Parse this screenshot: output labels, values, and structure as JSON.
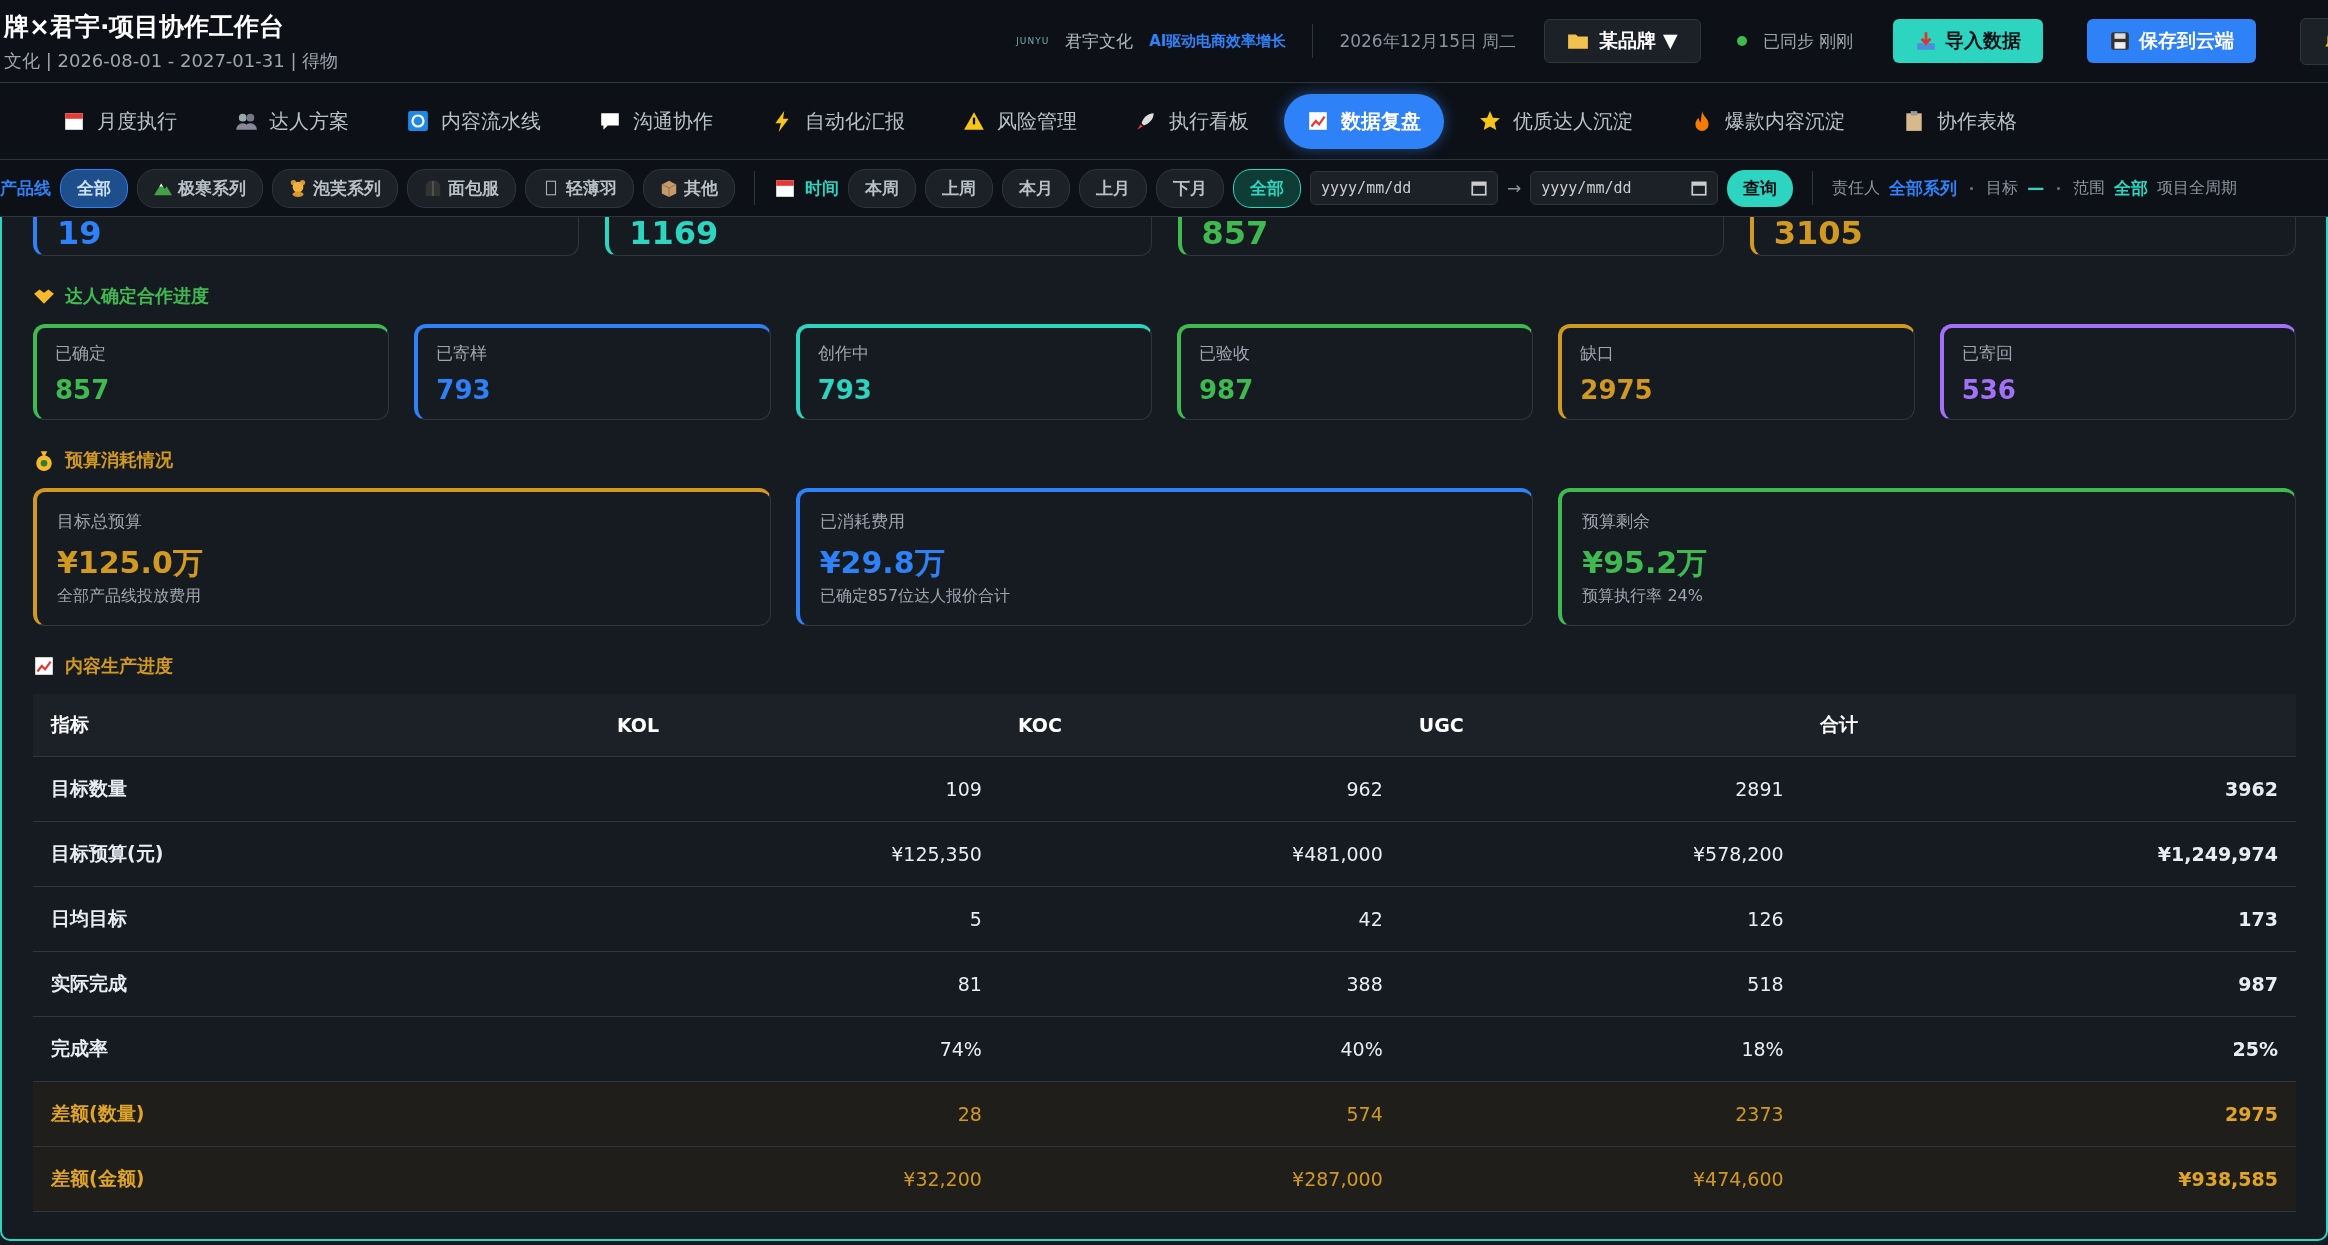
{
  "header": {
    "title": "牌×君宇·项目协作工作台",
    "subtitle": "文化 | 2026-08-01 - 2027-01-31 | 得物",
    "logo_text": "JUNYU",
    "company": "君宇文化",
    "slogan": "AI驱动电商效率增长",
    "date": "2026年12月15日 周二",
    "brand": "某品牌",
    "brand_caret": "▼",
    "sync_status": "已同步 刚刚",
    "import_button": "导入数据",
    "save_button": "保存到云端"
  },
  "nav_tabs": [
    {
      "label": "月度执行",
      "selected": false
    },
    {
      "label": "达人方案",
      "selected": false
    },
    {
      "label": "内容流水线",
      "selected": false
    },
    {
      "label": "沟通协作",
      "selected": false
    },
    {
      "label": "自动化汇报",
      "selected": false
    },
    {
      "label": "风险管理",
      "selected": false
    },
    {
      "label": "执行看板",
      "selected": false
    },
    {
      "label": "数据复盘",
      "selected": true
    },
    {
      "label": "优质达人沉淀",
      "selected": false
    },
    {
      "label": "爆款内容沉淀",
      "selected": false
    },
    {
      "label": "协作表格",
      "selected": false
    }
  ],
  "filters": {
    "product_label": "产品线",
    "products": [
      {
        "label": "全部",
        "selected": true
      },
      {
        "label": "极寒系列",
        "selected": false
      },
      {
        "label": "泡芙系列",
        "selected": false
      },
      {
        "label": "面包服",
        "selected": false
      },
      {
        "label": "轻薄羽",
        "selected": false
      },
      {
        "label": "其他",
        "selected": false
      }
    ],
    "time_label": "时间",
    "periods": [
      {
        "label": "本周",
        "selected": false
      },
      {
        "label": "上周",
        "selected": false
      },
      {
        "label": "本月",
        "selected": false
      },
      {
        "label": "上月",
        "selected": false
      },
      {
        "label": "下月",
        "selected": false
      },
      {
        "label": "全部",
        "selected": true
      }
    ],
    "date_from": {
      "placeholder": "yyyy/mm/dd"
    },
    "date_arrow": "→",
    "date_to": {
      "placeholder": "yyyy/mm/dd"
    },
    "query_button": "查询",
    "summary": [
      {
        "label": "责任人",
        "value": "全部系列",
        "color": "#2f81f7"
      },
      {
        "label": "目标",
        "value": "—",
        "color": "#2dd4bf"
      },
      {
        "label": "范围",
        "value": "全部",
        "color": "#2dd4bf"
      }
    ],
    "summary_note": "项目全周期"
  },
  "top_cards": [
    {
      "value": "19",
      "color": "#2f81f7"
    },
    {
      "value": "1169",
      "color": "#2dd4bf"
    },
    {
      "value": "857",
      "color": "#3fb950"
    },
    {
      "value": "3105",
      "color": "#d29922"
    }
  ],
  "progress": {
    "title": "达人确定合作进度",
    "cards": [
      {
        "label": "已确定",
        "value": "857",
        "color": "#3fb950"
      },
      {
        "label": "已寄样",
        "value": "793",
        "color": "#2f81f7"
      },
      {
        "label": "创作中",
        "value": "793",
        "color": "#2dd4bf"
      },
      {
        "label": "已验收",
        "value": "987",
        "color": "#3fb950"
      },
      {
        "label": "缺口",
        "value": "2975",
        "color": "#d29922"
      },
      {
        "label": "已寄回",
        "value": "536",
        "color": "#a371f7"
      }
    ]
  },
  "budget": {
    "title": "预算消耗情况",
    "cards": [
      {
        "label": "目标总预算",
        "value": "¥125.0万",
        "note": "全部产品线投放费用",
        "color": "#d29922"
      },
      {
        "label": "已消耗费用",
        "value": "¥29.8万",
        "note": "已确定857位达人报价合计",
        "color": "#2f81f7"
      },
      {
        "label": "预算剩余",
        "value": "¥95.2万",
        "note": "预算执行率 24%",
        "color": "#3fb950"
      }
    ]
  },
  "content": {
    "title": "内容生产进度",
    "columns": [
      "指标",
      "KOL",
      "KOC",
      "UGC",
      "合计"
    ],
    "rows": [
      {
        "kind": "normal",
        "cells": [
          "目标数量",
          "109",
          "962",
          "2891",
          "3962"
        ]
      },
      {
        "kind": "normal",
        "cells": [
          "目标预算(元)",
          "¥125,350",
          "¥481,000",
          "¥578,200",
          "¥1,249,974"
        ]
      },
      {
        "kind": "normal",
        "cells": [
          "日均目标",
          "5",
          "42",
          "126",
          "173"
        ]
      },
      {
        "kind": "normal",
        "cells": [
          "实际完成",
          "81",
          "388",
          "518",
          "987"
        ]
      },
      {
        "kind": "normal",
        "cells": [
          "完成率",
          "74%",
          "40%",
          "18%",
          "25%"
        ]
      },
      {
        "kind": "gap",
        "cells": [
          "差额(数量)",
          "28",
          "574",
          "2373",
          "2975"
        ]
      },
      {
        "kind": "gap",
        "cells": [
          "差额(金额)",
          "¥32,200",
          "¥287,000",
          "¥474,600",
          "¥938,585"
        ]
      }
    ]
  }
}
